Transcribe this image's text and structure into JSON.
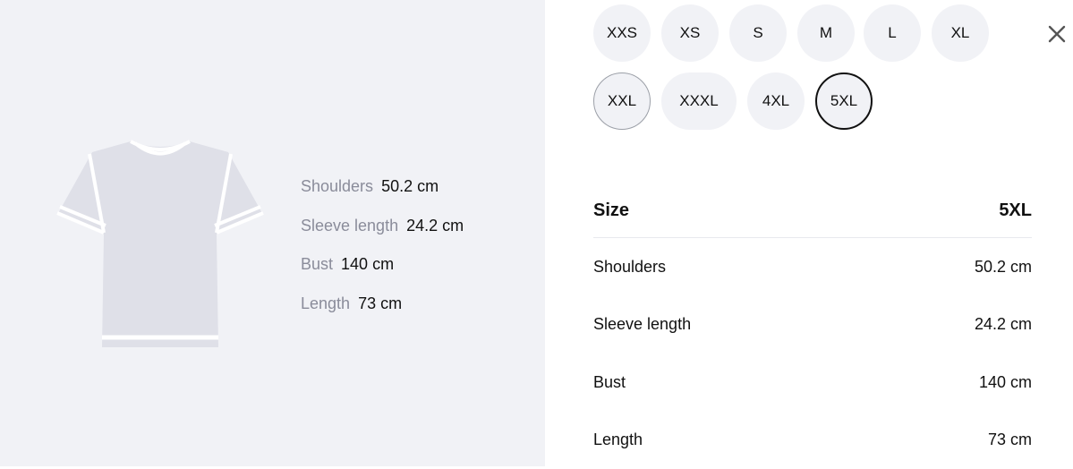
{
  "sizes": [
    {
      "label": "XXS",
      "state": "default"
    },
    {
      "label": "XS",
      "state": "default"
    },
    {
      "label": "S",
      "state": "default"
    },
    {
      "label": "M",
      "state": "default"
    },
    {
      "label": "L",
      "state": "default"
    },
    {
      "label": "XL",
      "state": "default"
    },
    {
      "label": "XXL",
      "state": "hover"
    },
    {
      "label": "XXXL",
      "state": "default"
    },
    {
      "label": "4XL",
      "state": "default"
    },
    {
      "label": "5XL",
      "state": "selected"
    }
  ],
  "diagram": {
    "items": [
      {
        "label": "Shoulders",
        "value": "50.2 cm"
      },
      {
        "label": "Sleeve length",
        "value": "24.2 cm"
      },
      {
        "label": "Bust",
        "value": "140 cm"
      },
      {
        "label": "Length",
        "value": "73 cm"
      }
    ]
  },
  "table": {
    "header_label": "Size",
    "header_value": "5XL",
    "rows": [
      {
        "label": "Shoulders",
        "value": "50.2 cm"
      },
      {
        "label": "Sleeve length",
        "value": "24.2 cm"
      },
      {
        "label": "Bust",
        "value": "140 cm"
      },
      {
        "label": "Length",
        "value": "73 cm"
      }
    ]
  },
  "colors": {
    "panel_bg": "#f1f2f6",
    "shirt_fill": "#dfe0e8",
    "shirt_outline": "#ffffff",
    "label_gray": "#8a8c9a",
    "selected_border": "#111111"
  },
  "icons": {
    "close": "close-icon",
    "shirt": "tshirt-icon"
  }
}
